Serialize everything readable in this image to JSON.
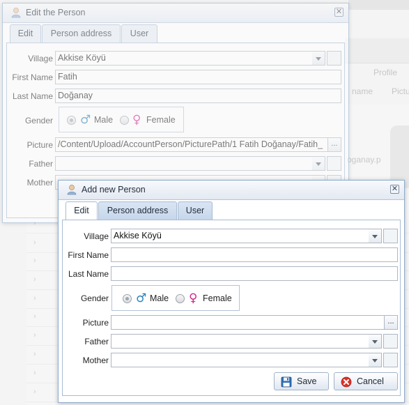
{
  "background": {
    "columns": [
      "Profile"
    ],
    "column_headers": [
      "name",
      "Pictu"
    ],
    "photo_filename": "oganay.p"
  },
  "back_dialog": {
    "title": "Edit the Person",
    "tabs": [
      {
        "label": "Edit",
        "active": true
      },
      {
        "label": "Person address",
        "active": false
      },
      {
        "label": "User",
        "active": false
      }
    ],
    "labels": {
      "village": "Village",
      "first_name": "First Name",
      "last_name": "Last Name",
      "gender": "Gender",
      "picture": "Picture",
      "father": "Father",
      "mother": "Mother"
    },
    "values": {
      "village": "Akkise Köyü",
      "first_name": "Fatih",
      "last_name": "Doğanay",
      "picture": "/Content/Upload/AccountPerson/PicturePath/1 Fatih Doğanay/Fatih_",
      "father": "",
      "mother": ""
    },
    "gender": {
      "male_label": "Male",
      "female_label": "Female",
      "selected": "Male"
    },
    "ellipsis": "..."
  },
  "front_dialog": {
    "title": "Add new Person",
    "tabs": [
      {
        "label": "Edit",
        "active": true
      },
      {
        "label": "Person address",
        "active": false
      },
      {
        "label": "User",
        "active": false
      }
    ],
    "labels": {
      "village": "Village",
      "first_name": "First Name",
      "last_name": "Last Name",
      "gender": "Gender",
      "picture": "Picture",
      "father": "Father",
      "mother": "Mother"
    },
    "values": {
      "village": "Akkise Köyü",
      "first_name": "",
      "last_name": "",
      "picture": "",
      "father": "",
      "mother": ""
    },
    "gender": {
      "male_label": "Male",
      "female_label": "Female",
      "selected": "Male"
    },
    "ellipsis": "...",
    "buttons": {
      "save": "Save",
      "cancel": "Cancel"
    }
  },
  "colors": {
    "border": "#8eaccc",
    "tab": "#c6d7eb",
    "male": "#2c83b9",
    "female": "#d0278c",
    "cancel_red": "#d9342b"
  },
  "icons": {
    "window": "person-icon",
    "close": "close-icon",
    "list": "list-lookup-icon",
    "save": "floppy-disk-icon",
    "cancel": "cancel-circle-icon"
  }
}
